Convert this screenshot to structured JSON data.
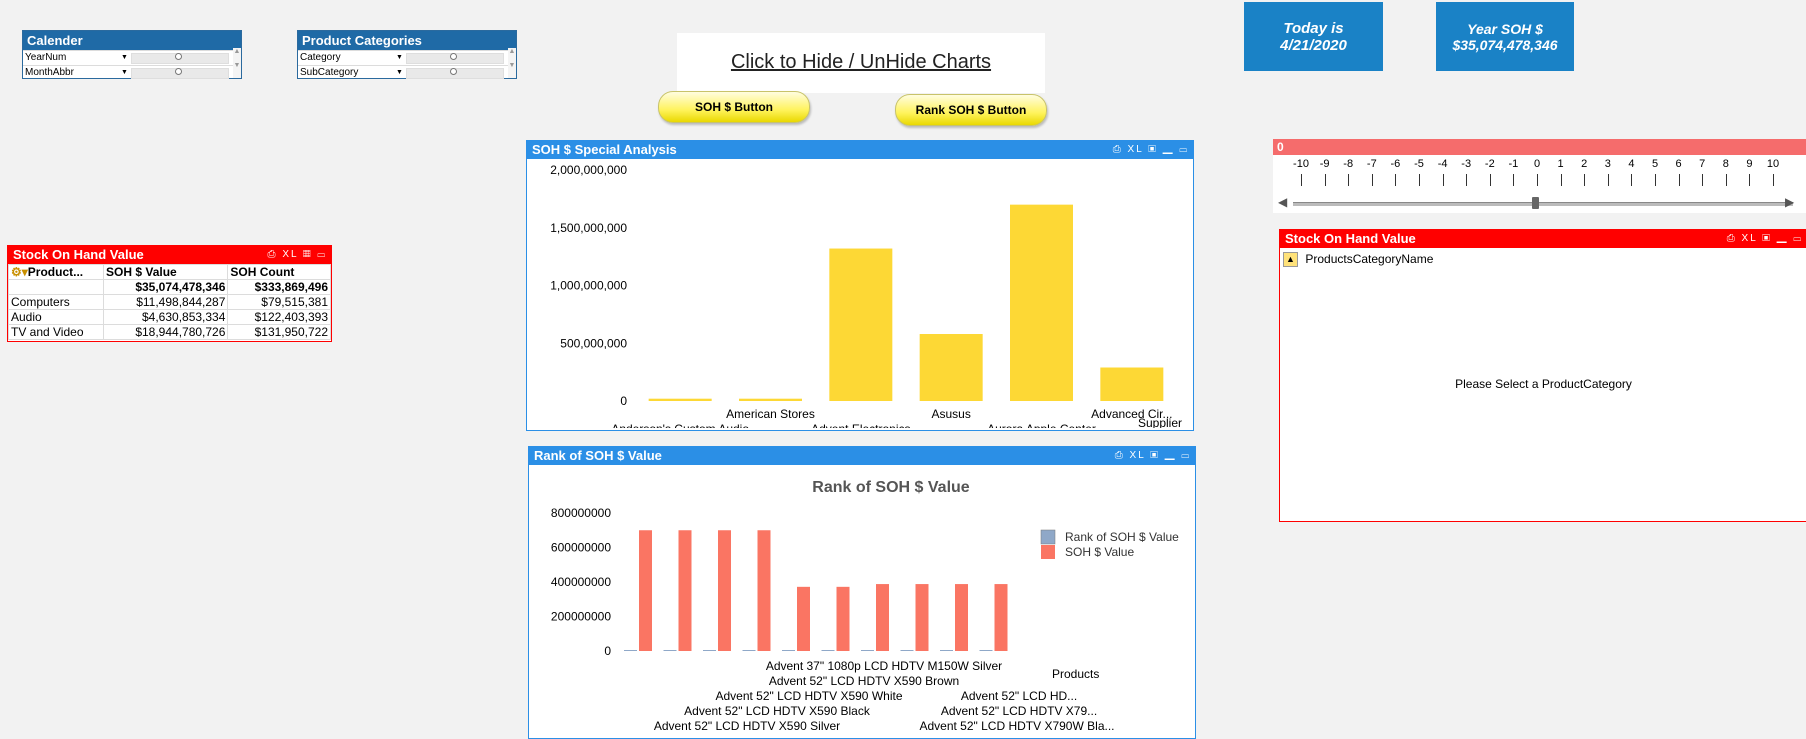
{
  "calendar": {
    "title": "Calender",
    "fields": [
      {
        "label": "YearNum"
      },
      {
        "label": "MonthAbbr"
      }
    ]
  },
  "product_categories": {
    "title": "Product Categories",
    "fields": [
      {
        "label": "Category"
      },
      {
        "label": "SubCategory"
      }
    ]
  },
  "toggle": {
    "label": "Click to Hide / UnHide Charts"
  },
  "buttons": {
    "soh": "SOH $ Button",
    "rank": "Rank SOH $ Button"
  },
  "today": {
    "line1": "Today is",
    "line2": "4/21/2020"
  },
  "year_soh": {
    "line1": "Year SOH $",
    "line2": "$35,074,478,346"
  },
  "stock_table": {
    "title": "Stock On Hand Value",
    "headers": [
      "Product...",
      "SOH $ Value",
      "SOH Count"
    ],
    "total": [
      "",
      "$35,074,478,346",
      "$333,869,496"
    ],
    "rows": [
      [
        "Computers",
        "$11,498,844,287",
        "$79,515,381"
      ],
      [
        "Audio",
        "$4,630,853,334",
        "$122,403,393"
      ],
      [
        "TV and Video",
        "$18,944,780,726",
        "$131,950,722"
      ]
    ]
  },
  "special": {
    "title": "SOH $ Special Analysis",
    "xlabel": "Supplier"
  },
  "rank": {
    "title": "Rank of SOH $ Value",
    "chart_title": "Rank of SOH $ Value",
    "xlabel": "Products"
  },
  "slider": {
    "value": "0",
    "ticks": [
      "-10",
      "-9",
      "-8",
      "-7",
      "-6",
      "-5",
      "-4",
      "-3",
      "-2",
      "-1",
      "0",
      "1",
      "2",
      "3",
      "4",
      "5",
      "6",
      "7",
      "8",
      "9",
      "10"
    ]
  },
  "stock_right": {
    "title": "Stock On Hand Value",
    "dimension": "ProductsCategoryName",
    "message": "Please Select a ProductCategory"
  },
  "panel_tools": "XL",
  "colors": {
    "blue_caption": "#2b8fe6",
    "red_caption": "#ff0000",
    "bar_yellow": "#fdd835",
    "bar_salmon": "#fa7563",
    "bar_blue": "#8fa8c8",
    "stat_blue": "#1a82c6"
  },
  "chart_data": [
    {
      "type": "bar",
      "title": "SOH $ Special Analysis",
      "xlabel": "Supplier",
      "categories": [
        "Anderson's Custom Audio",
        "American Stores",
        "Advent Electronics",
        "Asusus",
        "Aurora Apple Center",
        "Advanced Cir..."
      ],
      "values": [
        20000000,
        20000000,
        1320000000,
        580000000,
        1700000000,
        290000000
      ],
      "yticks": [
        "2,000,000,000",
        "1,500,000,000",
        "1,000,000,000",
        "500,000,000",
        "0"
      ],
      "ylim": [
        0,
        2000000000
      ]
    },
    {
      "type": "bar",
      "title": "Rank of SOH $ Value",
      "xlabel": "Products",
      "categories": [
        "Advent 52\" LCD HDTV X590 Silver",
        "Advent 52\" LCD HDTV X590 Black",
        "Advent 52\" LCD HDTV X590 White",
        "Advent 52\" LCD HDTV X590 Brown",
        "Advent 37\" 1080p LCD HDTV M150W Silver",
        "Advent 52\" LCD HDTV X790W Bla...",
        "Advent 52\" LCD HDTV X79...",
        "Advent 52\" LCD HD..."
      ],
      "series": [
        {
          "name": "Rank of SOH $ Value",
          "values": [
            1,
            1,
            1,
            1,
            1,
            1,
            1,
            1,
            1,
            1
          ]
        },
        {
          "name": "SOH $ Value",
          "values": [
            700000000,
            700000000,
            700000000,
            700000000,
            372000000,
            372000000,
            388000000,
            388000000,
            388000000,
            388000000
          ]
        }
      ],
      "yticks": [
        "800000000",
        "600000000",
        "400000000",
        "200000000",
        "0"
      ],
      "ylim": [
        0,
        800000000
      ],
      "legend": "top-right"
    }
  ]
}
